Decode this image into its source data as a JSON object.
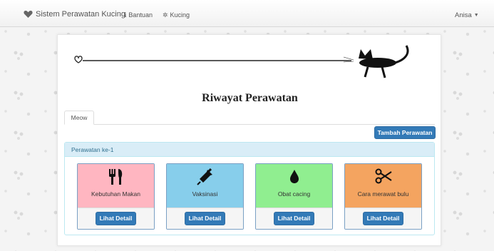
{
  "navbar": {
    "brand_label": "Sistem Perawatan Kucing",
    "links": [
      {
        "label": "Bantuan",
        "icon": "info-icon"
      },
      {
        "label": "Kucing",
        "icon": "cat-icon"
      }
    ],
    "user_label": "Anisa"
  },
  "page": {
    "title": "Riwayat Perawatan",
    "tab_label": "Meow",
    "add_button_label": "Tambah Perawatan",
    "care_header": "Perawatan ke-1",
    "cards": [
      {
        "label": "Kebutuhan Makan",
        "icon": "utensils-icon",
        "color": "#ffb6c1",
        "button": "Lihat Detail"
      },
      {
        "label": "Vaksinasi",
        "icon": "syringe-icon",
        "color": "#87ceeb",
        "button": "Lihat Detail"
      },
      {
        "label": "Obat cacing",
        "icon": "drop-icon",
        "color": "#90ee90",
        "button": "Lihat Detail"
      },
      {
        "label": "Cara merawat bulu",
        "icon": "scissors-icon",
        "color": "#f4a460",
        "button": "Lihat Detail"
      }
    ]
  },
  "colors": {
    "primary": "#337ab7",
    "info_bg": "#d9edf7",
    "info_text": "#31708f"
  }
}
